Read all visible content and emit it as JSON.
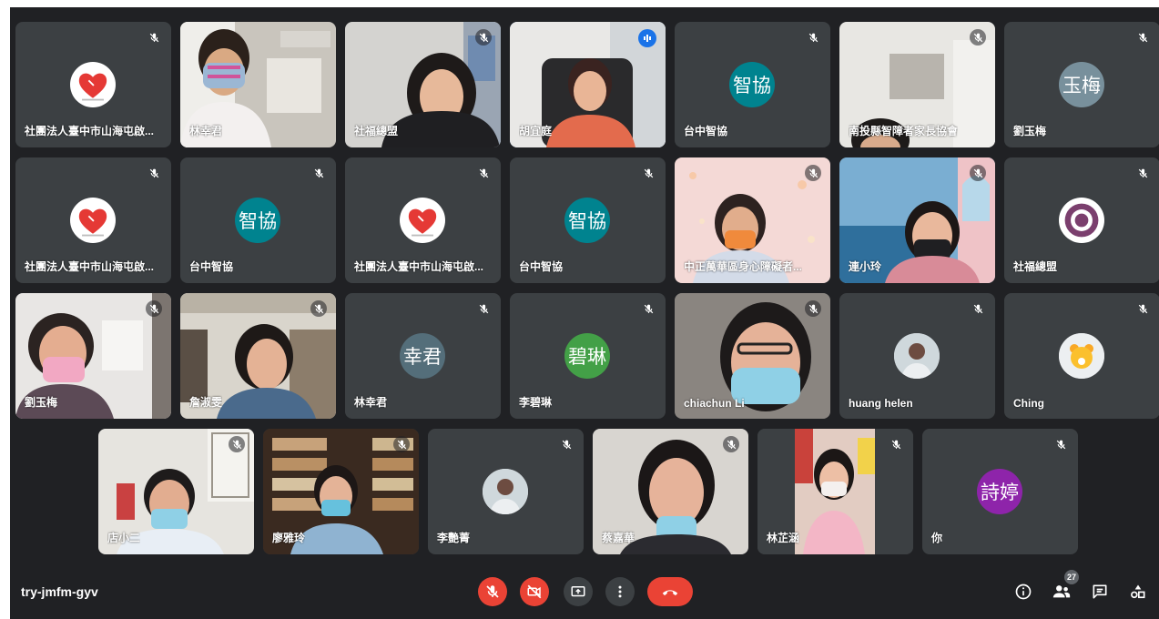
{
  "meeting": {
    "code": "try-jmfm-gyv",
    "participant_count": "27"
  },
  "colors": {
    "background": "#202124",
    "tile": "#3c4043",
    "danger": "#ea4335",
    "active_speaker": "#8ab4f8",
    "speaking_badge": "#1a73e8"
  },
  "participants": [
    {
      "name": "社團法人臺中市山海屯啟...",
      "avatar": "heart-logo",
      "muted": true
    },
    {
      "name": "林幸君",
      "avatar": "video",
      "muted": false
    },
    {
      "name": "社福總盟",
      "avatar": "video",
      "muted": true
    },
    {
      "name": "胡宜庭",
      "avatar": "video",
      "muted": false,
      "speaking": true
    },
    {
      "name": "台中智協",
      "initials": "智協",
      "avatar_color": "#00838f",
      "muted": true
    },
    {
      "name": "南投縣智障者家長協會",
      "avatar": "video",
      "muted": true
    },
    {
      "name": "劉玉梅",
      "initials": "玉梅",
      "avatar_color": "#78909c",
      "muted": true
    },
    {
      "name": "社團法人臺中市山海屯啟...",
      "avatar": "heart-logo",
      "muted": true
    },
    {
      "name": "台中智協",
      "initials": "智協",
      "avatar_color": "#00838f",
      "muted": true
    },
    {
      "name": "社團法人臺中市山海屯啟...",
      "avatar": "heart-logo",
      "muted": true
    },
    {
      "name": "台中智協",
      "initials": "智協",
      "avatar_color": "#00838f",
      "muted": true
    },
    {
      "name": "中正萬華區身心障礙者...",
      "avatar": "video",
      "muted": true
    },
    {
      "name": "連小玲",
      "avatar": "video",
      "muted": true
    },
    {
      "name": "社福總盟",
      "avatar": "seal-logo",
      "muted": true
    },
    {
      "name": "劉玉梅",
      "avatar": "video",
      "muted": true
    },
    {
      "name": "詹淑雯",
      "avatar": "video",
      "muted": true
    },
    {
      "name": "林幸君",
      "initials": "幸君",
      "avatar_color": "#546e7a",
      "muted": true
    },
    {
      "name": "李碧琳",
      "initials": "碧琳",
      "avatar_color": "#43a047",
      "muted": true
    },
    {
      "name": "chiachun Li",
      "avatar": "video",
      "muted": true
    },
    {
      "name": "huang helen",
      "avatar": "photo",
      "muted": true
    },
    {
      "name": "Ching",
      "avatar": "photo-yellow",
      "muted": true
    },
    {
      "name": "店小二",
      "avatar": "video",
      "muted": true
    },
    {
      "name": "廖雅玲",
      "avatar": "video",
      "muted": true
    },
    {
      "name": "李艷菁",
      "avatar": "photo",
      "muted": true
    },
    {
      "name": "蔡嘉華",
      "avatar": "video",
      "muted": true
    },
    {
      "name": "林芷涵",
      "avatar": "video",
      "muted": true
    },
    {
      "name": "你",
      "initials": "詩婷",
      "avatar_color": "#8e24aa",
      "muted": true
    }
  ],
  "controls": {
    "center": [
      "microphone-off-icon",
      "camera-off-icon",
      "present-screen-icon",
      "more-options-icon",
      "leave-call-icon"
    ],
    "right": [
      "meeting-details-icon",
      "people-icon",
      "chat-icon",
      "activities-icon"
    ]
  }
}
